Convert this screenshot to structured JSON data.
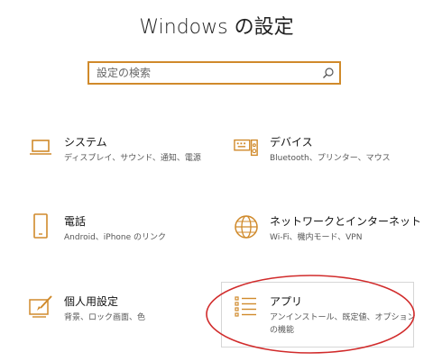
{
  "header": {
    "title": "Windows の設定"
  },
  "search": {
    "placeholder": "設定の検索"
  },
  "tiles": [
    {
      "title": "システム",
      "desc": "ディスプレイ、サウンド、通知、電源",
      "icon": "laptop-icon"
    },
    {
      "title": "デバイス",
      "desc": "Bluetooth、プリンター、マウス",
      "icon": "devices-icon"
    },
    {
      "title": "電話",
      "desc": "Android、iPhone のリンク",
      "icon": "phone-icon"
    },
    {
      "title": "ネットワークとインターネット",
      "desc": "Wi-Fi、機内モード、VPN",
      "icon": "globe-icon"
    },
    {
      "title": "個人用設定",
      "desc": "背景、ロック画面、色",
      "icon": "personalization-icon"
    },
    {
      "title": "アプリ",
      "desc": "アンインストール、既定値、オプション",
      "desc2": "の機能",
      "icon": "apps-list-icon"
    }
  ],
  "colors": {
    "accent": "#d08a2b",
    "annotation": "#d12b2b"
  }
}
